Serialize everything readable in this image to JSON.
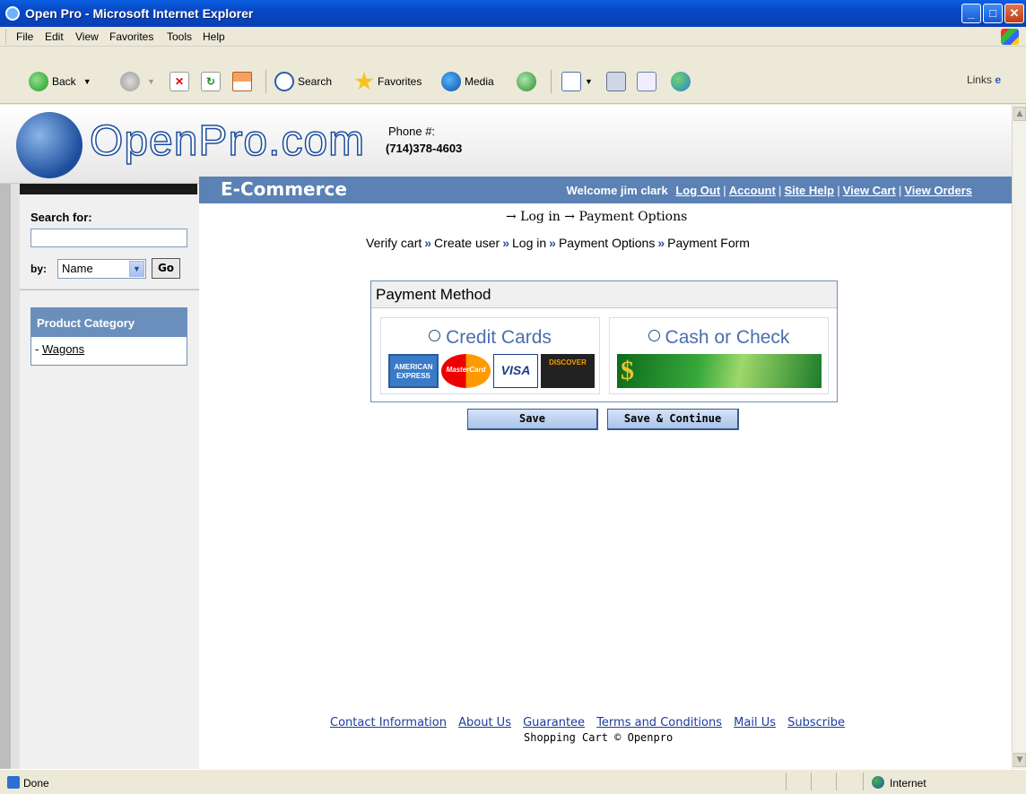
{
  "window": {
    "title": "Open Pro - Microsoft Internet Explorer"
  },
  "menu": [
    "File",
    "Edit",
    "View",
    "Favorites",
    "Tools",
    "Help"
  ],
  "toolbar": {
    "back": "Back",
    "search": "Search",
    "favorites": "Favorites",
    "media": "Media",
    "links": "Links"
  },
  "header": {
    "logo_text": "OpenPro.com",
    "phone_label": "Phone #:",
    "phone_number": "(714)378-4603"
  },
  "sidebar": {
    "search_label": "Search for:",
    "search_value": "",
    "by_label": "by:",
    "by_selected": "Name",
    "go_label": "Go",
    "category_title": "Product Category",
    "categories": [
      "Wagons"
    ]
  },
  "nav": {
    "brand": "E-Commerce",
    "welcome": "Welcome jim clark",
    "links": [
      "Log Out",
      "Account",
      "Site Help",
      "View Cart",
      "View Orders"
    ]
  },
  "breadcrumb": {
    "line1": "→ Log in → Payment Options",
    "steps": [
      "Verify cart",
      "Create user",
      "Log in",
      "Payment Options",
      "Payment Form"
    ]
  },
  "payment": {
    "title": "Payment Method",
    "option_credit": "Credit Cards",
    "option_cash": "Cash or Check",
    "cards": [
      "AMERICAN EXPRESS",
      "MasterCard",
      "VISA",
      "DISCOVER"
    ]
  },
  "buttons": {
    "save": "Save",
    "save_continue": "Save & Continue"
  },
  "footer": {
    "links": [
      "Contact Information",
      "About Us",
      "Guarantee",
      "Terms and Conditions",
      "Mail Us",
      "Subscribe"
    ],
    "copyright": "Shopping Cart © Openpro"
  },
  "status": {
    "text": "Done",
    "zone": "Internet"
  }
}
